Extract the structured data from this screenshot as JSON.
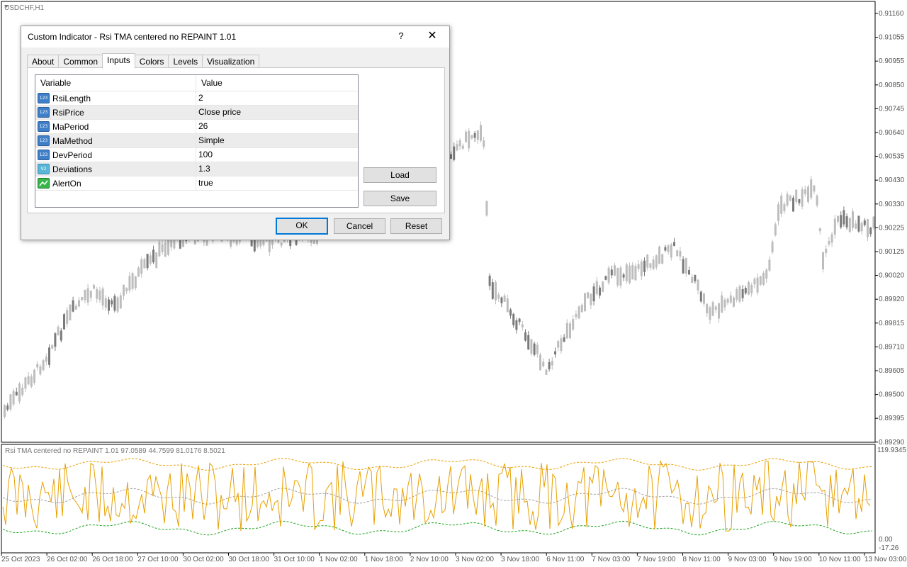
{
  "chart": {
    "symbol_label": "USDCHF,H1",
    "price_axis": [
      "0.91160",
      "0.91055",
      "0.90955",
      "0.90850",
      "0.90745",
      "0.90640",
      "0.90535",
      "0.90430",
      "0.90330",
      "0.90225",
      "0.90125",
      "0.90020",
      "0.89920",
      "0.89815",
      "0.89710",
      "0.89605",
      "0.89500",
      "0.89395",
      "0.89290"
    ],
    "indicator_title": "Rsi TMA centered no REPAINT 1.01 97.0589 44.7599 81.0176 8.5021",
    "indicator_axis": [
      "119.9345",
      "0.00",
      "-17.26"
    ],
    "time_axis": [
      "25 Oct 2023",
      "26 Oct 02:00",
      "26 Oct 18:00",
      "27 Oct 10:00",
      "30 Oct 02:00",
      "30 Oct 18:00",
      "31 Oct 10:00",
      "1 Nov 02:00",
      "1 Nov 18:00",
      "2 Nov 10:00",
      "3 Nov 02:00",
      "3 Nov 18:00",
      "6 Nov 11:00",
      "7 Nov 03:00",
      "7 Nov 19:00",
      "8 Nov 11:00",
      "9 Nov 03:00",
      "9 Nov 19:00",
      "10 Nov 11:00",
      "13 Nov 03:00"
    ],
    "colors": {
      "candle": "#bdbdbd",
      "candle_dark": "#7a7a7a",
      "rsi_line": "#e8a000",
      "upper_band": "#e8a000",
      "mid_band": "#a0a0a0",
      "lower_band": "#1aa31a"
    }
  },
  "dialog": {
    "title": "Custom Indicator - Rsi TMA centered no REPAINT 1.01",
    "help": "?",
    "close": "✕",
    "tabs": [
      "About",
      "Common",
      "Inputs",
      "Colors",
      "Levels",
      "Visualization"
    ],
    "active_tab": "Inputs",
    "grid": {
      "headers": [
        "Variable",
        "Value"
      ],
      "rows": [
        {
          "icon": "123",
          "type": "int",
          "name": "RsiLength",
          "value": "2"
        },
        {
          "icon": "123",
          "type": "int",
          "name": "RsiPrice",
          "value": "Close price"
        },
        {
          "icon": "123",
          "type": "int",
          "name": "MaPeriod",
          "value": "26"
        },
        {
          "icon": "123",
          "type": "int",
          "name": "MaMethod",
          "value": "Simple"
        },
        {
          "icon": "123",
          "type": "int",
          "name": "DevPeriod",
          "value": "100"
        },
        {
          "icon": "V2",
          "type": "dbl",
          "name": "Deviations",
          "value": "1.3"
        },
        {
          "icon": "",
          "type": "bool",
          "name": "AlertOn",
          "value": "true"
        }
      ]
    },
    "buttons": {
      "load": "Load",
      "save": "Save",
      "ok": "OK",
      "cancel": "Cancel",
      "reset": "Reset"
    }
  }
}
